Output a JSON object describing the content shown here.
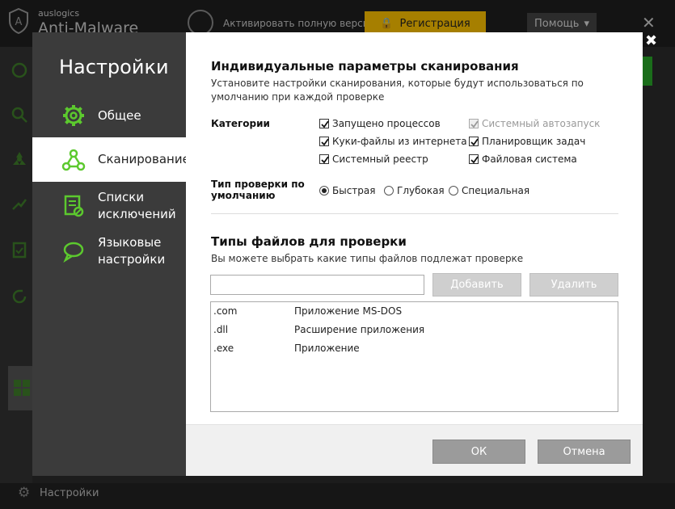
{
  "app": {
    "brand_small": "auslogics",
    "brand_big": "Anti-Malware",
    "activate_text": "Активировать полную версию",
    "register_label": "Регистрация",
    "help_label": "Помощь",
    "status_label": "Настройки"
  },
  "dialog": {
    "title": "Настройки",
    "nav": [
      {
        "label": "Общее",
        "icon": "gear-icon"
      },
      {
        "label": "Сканирование",
        "icon": "nodes-icon"
      },
      {
        "label": "Списки исключений",
        "icon": "list-icon"
      },
      {
        "label": "Языковые настройки",
        "icon": "chat-bubble-icon"
      }
    ],
    "scan": {
      "heading": "Индивидуальные параметры сканирования",
      "description": "Установите настройки сканирования, которые будут использоваться по умолчанию при каждой проверке",
      "categories_label": "Категории",
      "categories": [
        {
          "label": "Запущено процессов",
          "checked": true,
          "disabled": false
        },
        {
          "label": "Системный автозапуск",
          "checked": true,
          "disabled": true
        },
        {
          "label": "Куки-файлы из интернета",
          "checked": true,
          "disabled": false
        },
        {
          "label": "Планировщик задач",
          "checked": true,
          "disabled": false
        },
        {
          "label": "Системный реестр",
          "checked": true,
          "disabled": false
        },
        {
          "label": "Файловая система",
          "checked": true,
          "disabled": false
        }
      ],
      "scan_type_label": "Тип проверки по умолчанию",
      "scan_types": [
        {
          "label": "Быстрая",
          "selected": true
        },
        {
          "label": "Глубокая",
          "selected": false
        },
        {
          "label": "Специальная",
          "selected": false
        }
      ]
    },
    "filetypes": {
      "heading": "Типы файлов для проверки",
      "description": "Вы можете выбрать какие типы файлов подлежат проверке",
      "input_value": "",
      "add_label": "Добавить",
      "remove_label": "Удалить",
      "rows": [
        {
          "ext": ".com",
          "desc": "Приложение MS-DOS"
        },
        {
          "ext": ".dll",
          "desc": "Расширение приложения"
        },
        {
          "ext": ".exe",
          "desc": "Приложение"
        }
      ]
    },
    "ok_label": "ОК",
    "cancel_label": "Отмена",
    "close_glyph": "✖"
  },
  "colors": {
    "accent_green": "#5cc92e",
    "nav_bg": "#3b3b3b",
    "register_yellow": "#ffc400"
  }
}
